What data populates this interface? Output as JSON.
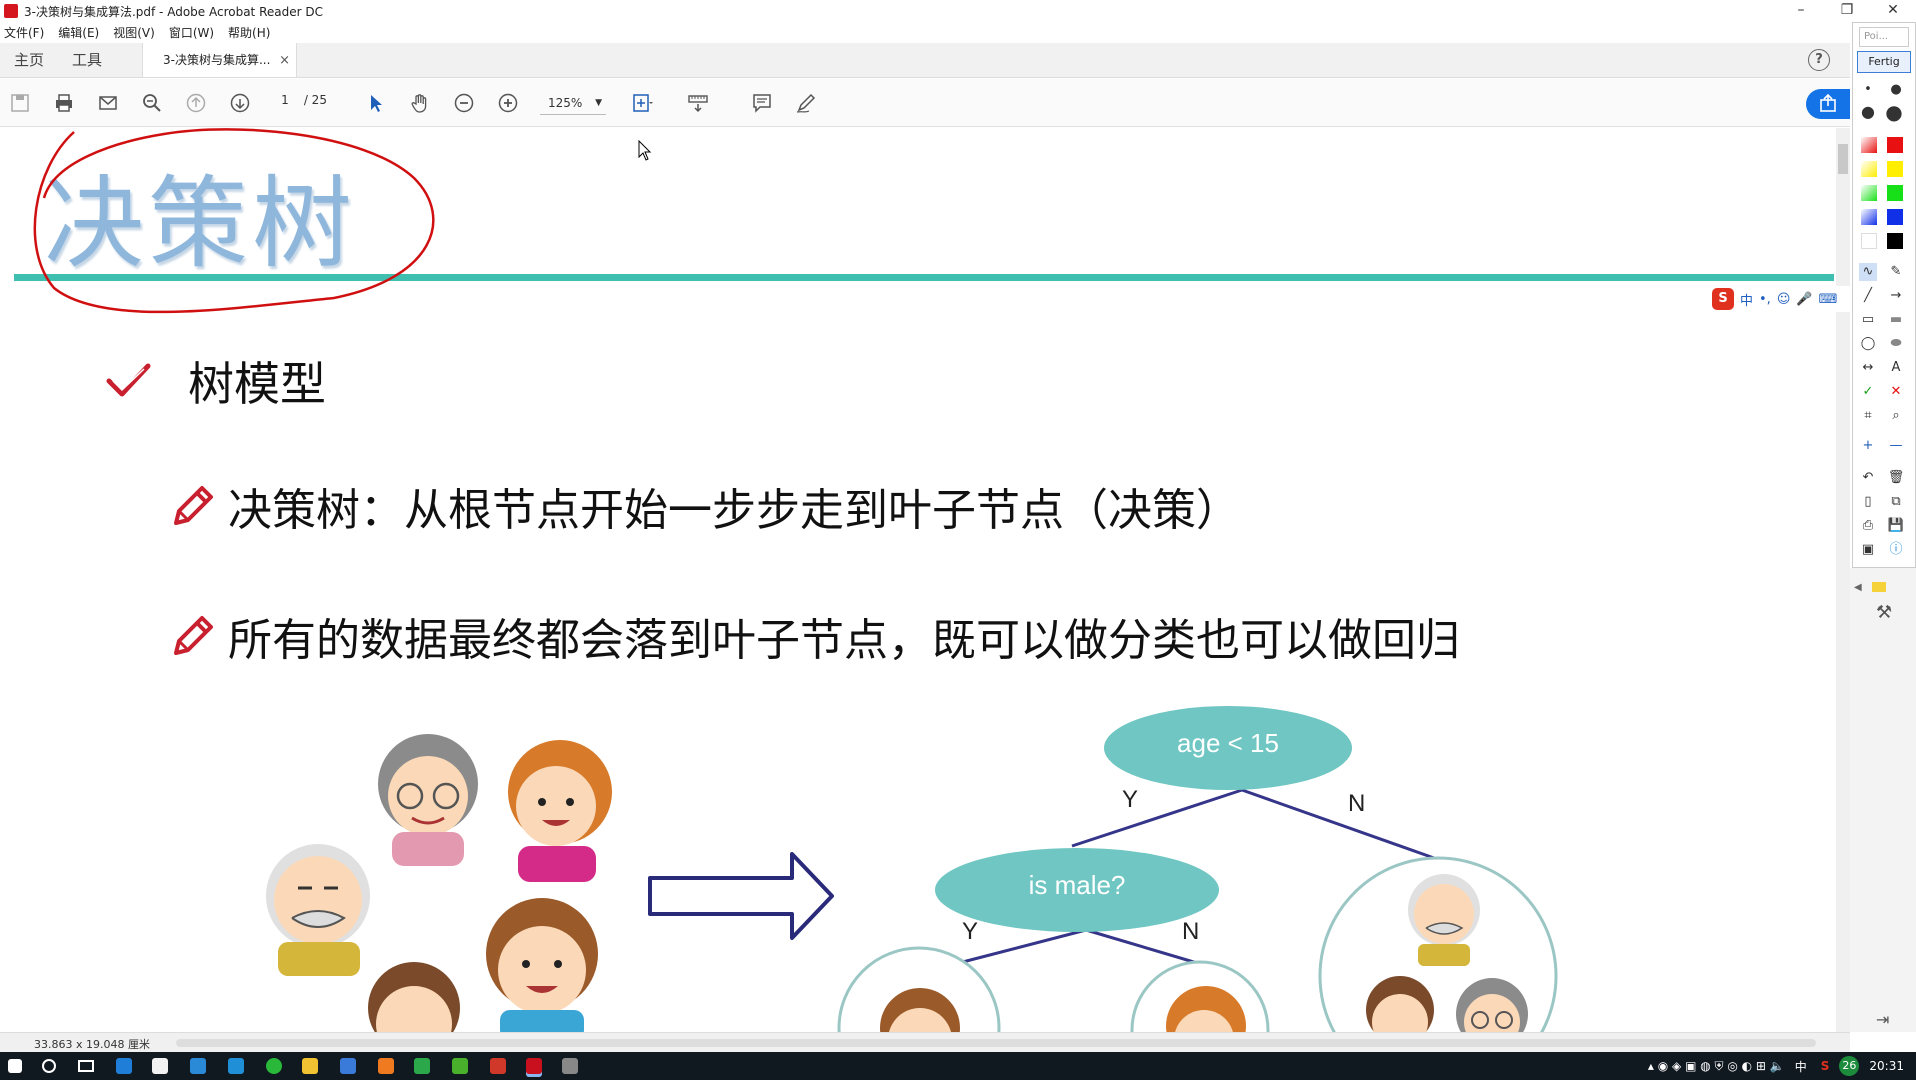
{
  "window": {
    "title": "3-决策树与集成算法.pdf - Adobe Acrobat Reader DC",
    "minimize": "–",
    "restore": "❐",
    "close": "✕"
  },
  "menu": [
    "文件(F)",
    "编辑(E)",
    "视图(V)",
    "窗口(W)",
    "帮助(H)"
  ],
  "tabs": {
    "home": "主页",
    "tools": "工具",
    "document": "3-决策树与集成算...",
    "close": "×",
    "help": "?"
  },
  "toolbar": {
    "page_current": "1",
    "page_total": "/ 25",
    "zoom": "125%"
  },
  "slide": {
    "title": "决策树",
    "heading": "树模型",
    "bullets": [
      "决策树：从根节点开始一步步走到叶子节点（决策）",
      "所有的数据最终都会落到叶子节点，既可以做分类也可以做回归"
    ]
  },
  "tree": {
    "root": "age < 15",
    "child": "is male?",
    "yes": "Y",
    "no": "N"
  },
  "statusbar": {
    "dimensions": "33.863 x 19.048 厘米"
  },
  "pentool": {
    "input": "Poi...",
    "done": "Fertig",
    "colors": [
      "#e81010",
      "#ffee00",
      "#18e018",
      "#1030e8",
      "#000000"
    ]
  },
  "ime": {
    "logo": "S",
    "mode": "中"
  },
  "taskbar": {
    "lang": "中",
    "badge": "26",
    "time": "20:31"
  }
}
